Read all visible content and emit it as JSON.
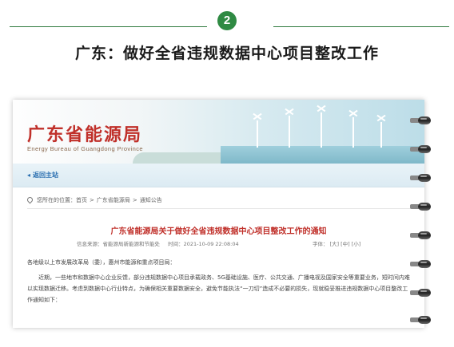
{
  "section": {
    "number": "2",
    "headline": "广东：做好全省违规数据中心项目整改工作"
  },
  "site": {
    "name_cn": "广东省能源局",
    "name_en": "Energy Bureau of Guangdong Province",
    "back_label": "返回主站"
  },
  "breadcrumb": {
    "prefix": "您所在的位置：",
    "items": [
      "首页",
      "广东省能源局",
      "通知公告"
    ],
    "separator": ">"
  },
  "article": {
    "title": "广东省能源局关于做好全省违规数据中心项目整改工作的通知",
    "source": "信息来源：省能源局新能源和节能处",
    "time": "时间：2021-10-09 22:08:04",
    "font_label": "字体：",
    "font_options": [
      "[大]",
      "[中]",
      "[小]"
    ],
    "salutation": "各地级以上市发展改革局（委），惠州市能源和重点项目局：",
    "paragraph": "近期，一些地市和数据中心企业反馈，部分违规数据中心项目承载政务、5G基础设施、医疗、公共交通、广播电视及国家安全等重要业务，短时间内难以实现数据迁移。考虑到数据中心行业特点，为确保相关重要数据安全，避免节能执法“一刀切”造成不必要的损失，现就稳妥推进违规数据中心项目整改工作通知如下："
  },
  "colors": {
    "accent_green": "#2f8a43",
    "brand_red": "#c0302a",
    "link_blue": "#2a6fb0"
  }
}
